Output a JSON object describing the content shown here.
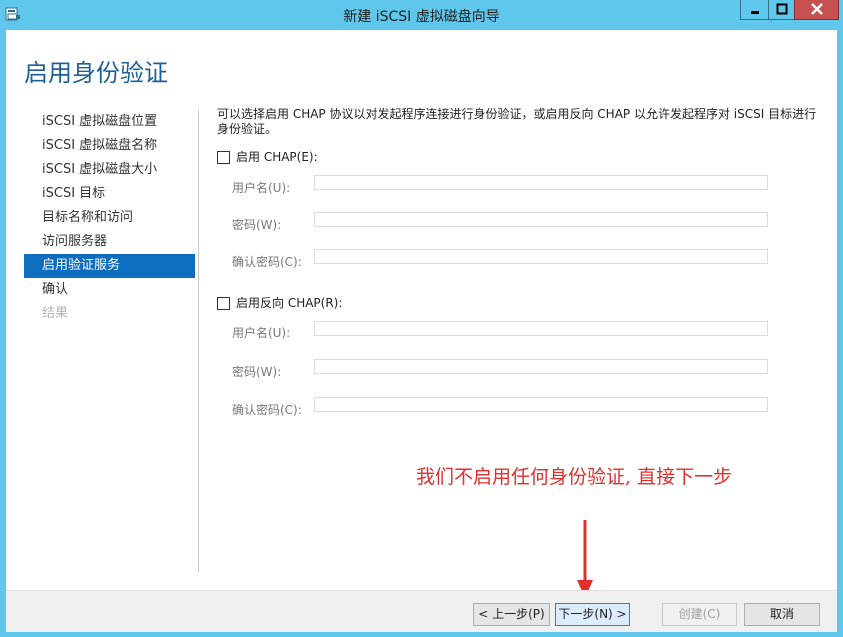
{
  "window": {
    "title": "新建 iSCSI 虚拟磁盘向导",
    "controls": {
      "minimize": "minimize-icon",
      "maximize": "maximize-icon",
      "close": "close-icon"
    }
  },
  "page": {
    "title": "启用身份验证"
  },
  "nav": {
    "items": [
      {
        "label": "iSCSI 虚拟磁盘位置",
        "state": "normal"
      },
      {
        "label": "iSCSI 虚拟磁盘名称",
        "state": "normal"
      },
      {
        "label": "iSCSI 虚拟磁盘大小",
        "state": "normal"
      },
      {
        "label": "iSCSI 目标",
        "state": "normal"
      },
      {
        "label": "目标名称和访问",
        "state": "normal"
      },
      {
        "label": "访问服务器",
        "state": "normal"
      },
      {
        "label": "启用验证服务",
        "state": "active"
      },
      {
        "label": "确认",
        "state": "normal"
      },
      {
        "label": "结果",
        "state": "disabled"
      }
    ]
  },
  "content": {
    "description": "可以选择启用 CHAP 协议以对发起程序连接进行身份验证，或启用反向 CHAP 以允许发起程序对 iSCSI 目标进行身份验证。",
    "chap": {
      "checkbox_label": "启用 CHAP(E):",
      "checked": false,
      "username_label": "用户名(U):",
      "username_value": "",
      "password_label": "密码(W):",
      "password_value": "",
      "confirm_label": "确认密码(C):",
      "confirm_value": ""
    },
    "reverse_chap": {
      "checkbox_label": "启用反向 CHAP(R):",
      "checked": false,
      "username_label": "用户名(U):",
      "username_value": "",
      "password_label": "密码(W):",
      "password_value": "",
      "confirm_label": "确认密码(C):",
      "confirm_value": ""
    }
  },
  "annotation": {
    "text": "我们不启用任何身份验证, 直接下一步",
    "color": "#e0302c"
  },
  "footer": {
    "prev_label": "< 上一步(P)",
    "next_label": "下一步(N) >",
    "create_label": "创建(C)",
    "cancel_label": "取消"
  },
  "colors": {
    "titlebar": "#5fc6ec",
    "accent": "#0d6dbf",
    "page_title": "#1f5f99"
  }
}
